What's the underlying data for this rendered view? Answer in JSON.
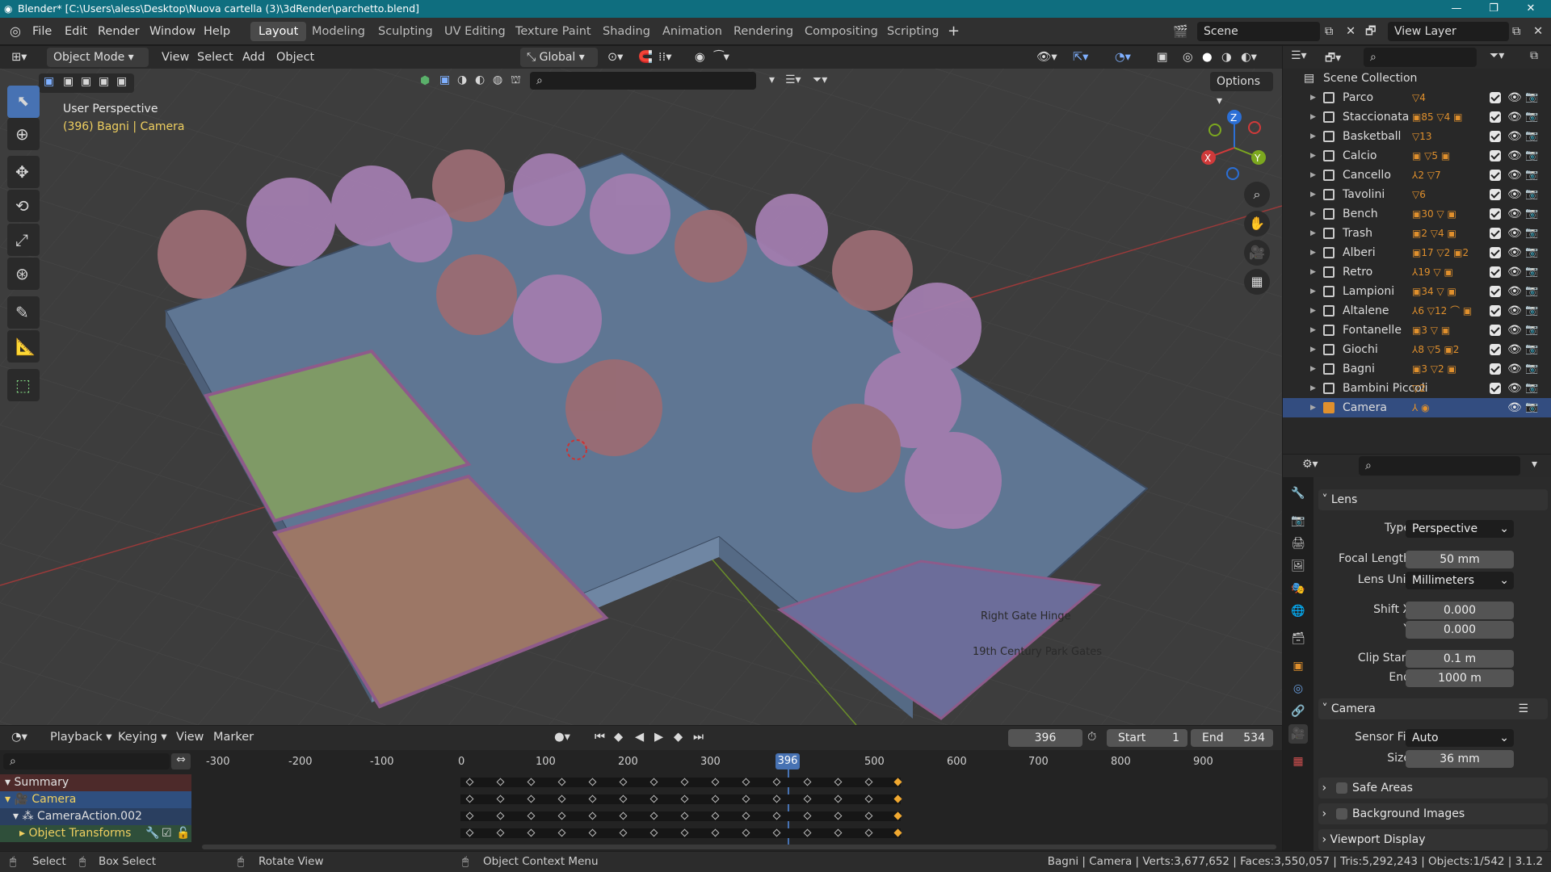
{
  "window": {
    "title": "Blender* [C:\\Users\\aless\\Desktop\\Nuova cartella (3)\\3dRender\\parchetto.blend]"
  },
  "menu": {
    "items": [
      "File",
      "Edit",
      "Render",
      "Window",
      "Help"
    ]
  },
  "workspaces": [
    "Layout",
    "Modeling",
    "Sculpting",
    "UV Editing",
    "Texture Paint",
    "Shading",
    "Animation",
    "Rendering",
    "Compositing",
    "Scripting"
  ],
  "active_workspace": "Layout",
  "scene": {
    "label": "Scene",
    "view_layer": "View Layer"
  },
  "viewport_header": {
    "mode": "Object Mode",
    "menus": [
      "View",
      "Select",
      "Add",
      "Object"
    ],
    "orientation": "Global",
    "options_label": "Options"
  },
  "viewport": {
    "perspective_label": "User Perspective",
    "context_label": "(396) Bagni | Camera",
    "annotations": [
      "Right Gate Hinge",
      "19th Century Park Gates"
    ],
    "gizmo_axes": {
      "x": "X",
      "y": "Y",
      "z": "Z"
    }
  },
  "outliner": {
    "root": "Scene Collection",
    "collections": [
      {
        "name": "Parco",
        "tags": "▽4"
      },
      {
        "name": "Staccionata",
        "tags": "▣85 ▽4 ▣"
      },
      {
        "name": "Basketball",
        "tags": "▽13"
      },
      {
        "name": "Calcio",
        "tags": "▣ ▽5 ▣"
      },
      {
        "name": "Cancello",
        "tags": "⅄2 ▽7"
      },
      {
        "name": "Tavolini",
        "tags": "▽6"
      },
      {
        "name": "Bench",
        "tags": "▣30 ▽ ▣"
      },
      {
        "name": "Trash",
        "tags": "▣2 ▽4 ▣"
      },
      {
        "name": "Alberi",
        "tags": "▣17 ▽2 ▣2"
      },
      {
        "name": "Retro",
        "tags": "⅄19 ▽ ▣"
      },
      {
        "name": "Lampioni",
        "tags": "▣34 ▽ ▣"
      },
      {
        "name": "Altalene",
        "tags": "⅄6 ▽12 ⌒ ▣"
      },
      {
        "name": "Fontanelle",
        "tags": "▣3 ▽ ▣"
      },
      {
        "name": "Giochi",
        "tags": "⅄8 ▽5 ▣2"
      },
      {
        "name": "Bagni",
        "tags": "▣3 ▽2 ▣"
      },
      {
        "name": "Bambini Piccoli",
        "tags": "▽2"
      },
      {
        "name": "Camera",
        "tags": "⅄ ◉",
        "selected": true
      }
    ]
  },
  "properties": {
    "lens_panel": "Lens",
    "type_label": "Type",
    "type_value": "Perspective",
    "focal_label": "Focal Length",
    "focal_value": "50 mm",
    "lensunit_label": "Lens Unit",
    "lensunit_value": "Millimeters",
    "shiftx_label": "Shift X",
    "shiftx_value": "0.000",
    "shifty_label": "Y",
    "shifty_value": "0.000",
    "clipstart_label": "Clip Start",
    "clipstart_value": "0.1 m",
    "clipend_label": "End",
    "clipend_value": "1000 m",
    "camera_panel": "Camera",
    "sensorfit_label": "Sensor Fit",
    "sensorfit_value": "Auto",
    "size_label": "Size",
    "size_value": "36 mm",
    "safe_areas": "Safe Areas",
    "bg_images": "Background Images",
    "viewport_display": "Viewport Display"
  },
  "timeline": {
    "menus": [
      "Playback",
      "Keying",
      "View",
      "Marker"
    ],
    "current_frame": "396",
    "start_label": "Start",
    "start_value": "1",
    "end_label": "End",
    "end_value": "534",
    "ruler": [
      "-300",
      "-200",
      "-100",
      "0",
      "100",
      "200",
      "300",
      "396",
      "500",
      "600",
      "700",
      "800",
      "900"
    ],
    "channels": [
      "Summary",
      "Camera",
      "CameraAction.002",
      "Object Transforms"
    ]
  },
  "statusbar": {
    "select": "Select",
    "box_select": "Box Select",
    "rotate": "Rotate View",
    "context_menu": "Object Context Menu",
    "stats": "Bagni | Camera | Verts:3,677,652 | Faces:3,550,057 | Tris:5,292,243 | Objects:1/542 | 3.1.2"
  },
  "colors": {
    "accent": "#4772b3",
    "selected_row": "#334d80",
    "titlebar": "#0f6e7f",
    "keyframe": "#f0a830"
  }
}
